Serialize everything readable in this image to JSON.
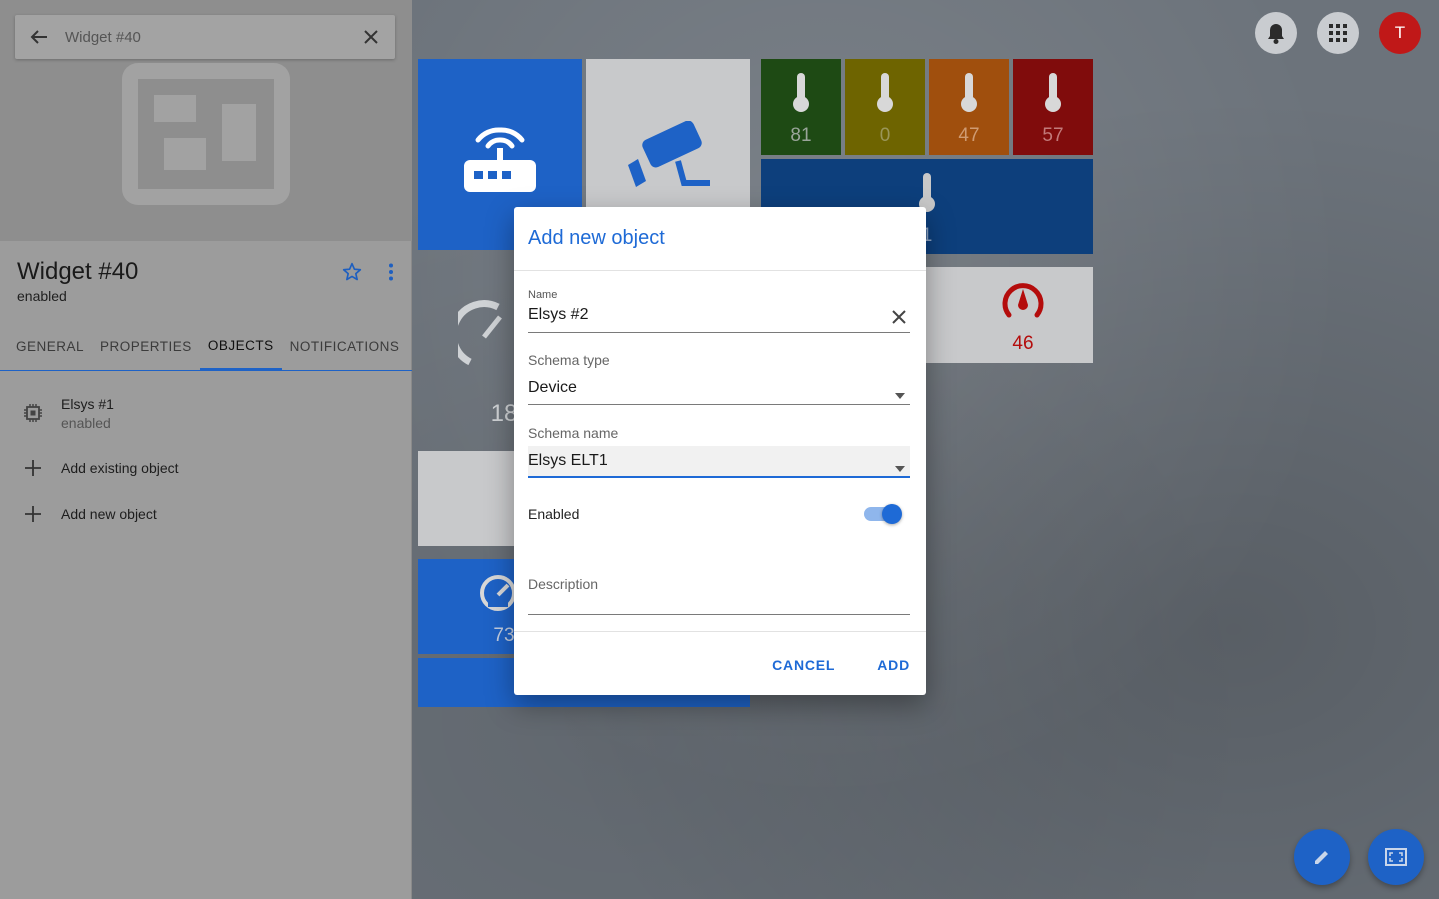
{
  "sidebar": {
    "search_value": "Widget #40",
    "title": "Widget #40",
    "status": "enabled",
    "tabs": [
      "GENERAL",
      "PROPERTIES",
      "OBJECTS",
      "NOTIFICATIONS"
    ],
    "objects": [
      {
        "name": "Elsys #1",
        "status": "enabled"
      }
    ],
    "add_existing_label": "Add existing object",
    "add_new_label": "Add new object"
  },
  "dialog": {
    "title": "Add new object",
    "name_label": "Name",
    "name_value": "Elsys #2",
    "schema_type_label": "Schema type",
    "schema_type_value": "Device",
    "schema_name_label": "Schema name",
    "schema_name_value": "Elsys ELT1",
    "enabled_label": "Enabled",
    "enabled": true,
    "description_label": "Description",
    "cancel_label": "CANCEL",
    "add_label": "ADD"
  },
  "dashboard": {
    "temp_values": [
      "81",
      "0",
      "47",
      "57"
    ],
    "wide_temp_value": "1",
    "pressure_value": "46",
    "gauge_value": "18",
    "speed_value": "73",
    "avatar_letter": "T"
  },
  "colors": {
    "accent": "#1e6ad6",
    "tile_blue": "#1e62c6",
    "temp_green": "#1e4a14",
    "temp_yellow": "#6e6400",
    "temp_orange": "#a04f0d",
    "temp_red": "#800c0c",
    "dark_blue": "#0d3f7c",
    "avatar_red": "#c01818"
  }
}
